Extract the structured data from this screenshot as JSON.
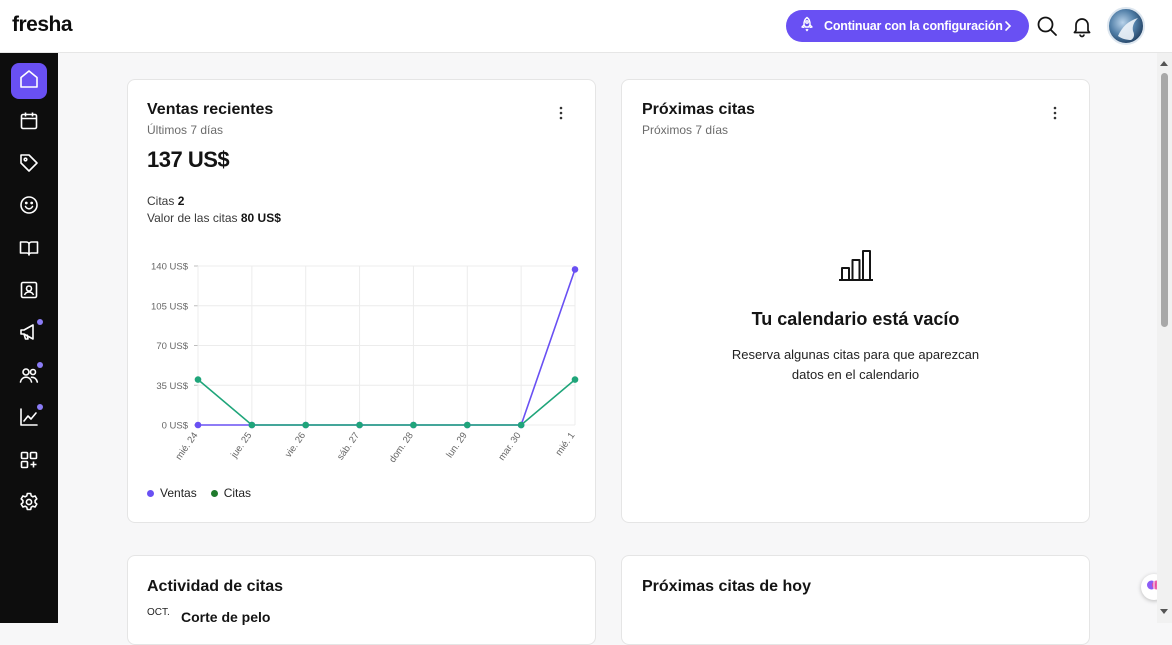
{
  "app": {
    "logo": "fresha"
  },
  "header": {
    "cta_label": "Continuar con la configuración",
    "icons": [
      "search-icon",
      "bell-icon",
      "avatar"
    ]
  },
  "sidebar": {
    "items": [
      {
        "icon": "home-icon",
        "active": true
      },
      {
        "icon": "calendar-icon"
      },
      {
        "icon": "tag-icon"
      },
      {
        "icon": "smiley-icon"
      },
      {
        "icon": "book-icon"
      },
      {
        "icon": "contact-card-icon"
      },
      {
        "icon": "megaphone-icon",
        "badge": true
      },
      {
        "icon": "team-icon",
        "badge": true
      },
      {
        "icon": "chart-icon",
        "badge": true
      },
      {
        "icon": "add-apps-icon"
      },
      {
        "icon": "gear-icon"
      }
    ]
  },
  "sales_card": {
    "title": "Ventas recientes",
    "subtitle": "Últimos 7 días",
    "total": "137 US$",
    "citas_label": "Citas",
    "citas_value": "2",
    "valor_label": "Valor de las citas",
    "valor_value": "80 US$"
  },
  "chart_data": {
    "type": "line",
    "x": [
      "mié. 24",
      "jue. 25",
      "vie. 26",
      "sáb. 27",
      "dom. 28",
      "lun. 29",
      "mar. 30",
      "mié. 1"
    ],
    "y_ticks": [
      "0 US$",
      "35 US$",
      "70 US$",
      "105 US$",
      "140 US$"
    ],
    "ylim": [
      0,
      140
    ],
    "series": [
      {
        "name": "Ventas",
        "color": "#6950f3",
        "values": [
          0,
          0,
          0,
          0,
          0,
          0,
          0,
          137
        ]
      },
      {
        "name": "Citas",
        "color": "#1fa57a",
        "values": [
          40,
          0,
          0,
          0,
          0,
          0,
          0,
          40
        ]
      }
    ],
    "legend_position": "bottom-left",
    "grid": true
  },
  "legend": {
    "ventas": "Ventas",
    "citas": "Citas"
  },
  "upcoming_card": {
    "title": "Próximas citas",
    "subtitle": "Próximos 7 días",
    "empty_title": "Tu calendario está vacío",
    "empty_desc": "Reserva algunas citas para que aparezcan datos en el calendario"
  },
  "activity_card": {
    "title": "Actividad de citas",
    "first_month": "OCT.",
    "first_item": "Corte de pelo"
  },
  "today_card": {
    "title": "Próximas citas de hoy"
  }
}
